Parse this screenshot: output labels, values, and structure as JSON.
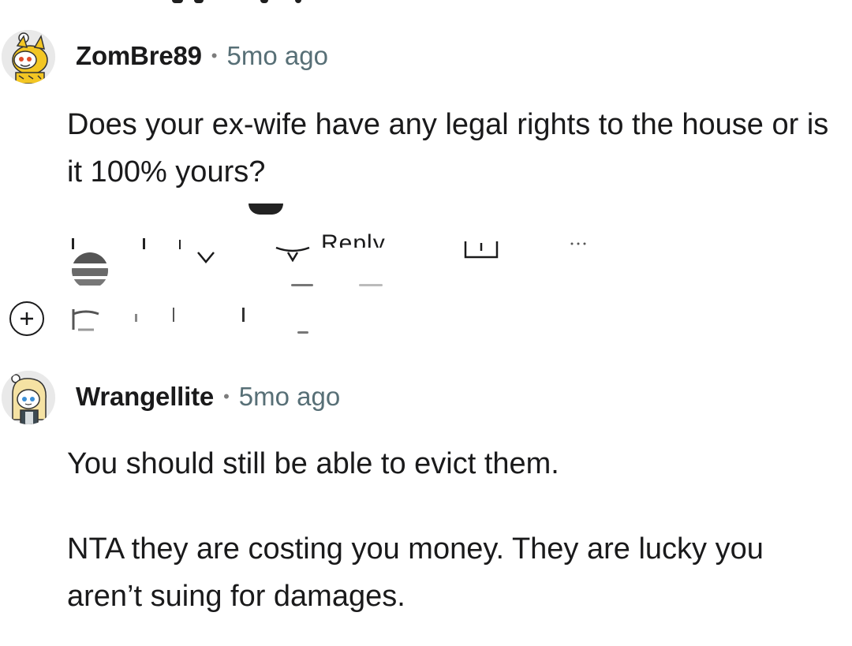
{
  "comments": [
    {
      "username": "ZomBre89",
      "separator": "•",
      "timestamp": "5mo ago",
      "body": [
        "Does your ex-wife have any legal rights to the house or is it 100% yours?"
      ],
      "avatar_icon": "snoo-avatar-yellow-costume-icon"
    },
    {
      "username": "Wrangellite",
      "separator": "•",
      "timestamp": "5mo ago",
      "body": [
        "You should still be able to evict them.",
        "NTA they are costing you money. They are lucky you aren’t suing for damages."
      ],
      "avatar_icon": "snoo-avatar-blonde-hair-icon"
    }
  ],
  "actions": {
    "reply_label": "Reply",
    "expand_symbol": "+"
  },
  "colors": {
    "text": "#1a1a1b",
    "meta": "#576f76",
    "background": "#ffffff"
  }
}
